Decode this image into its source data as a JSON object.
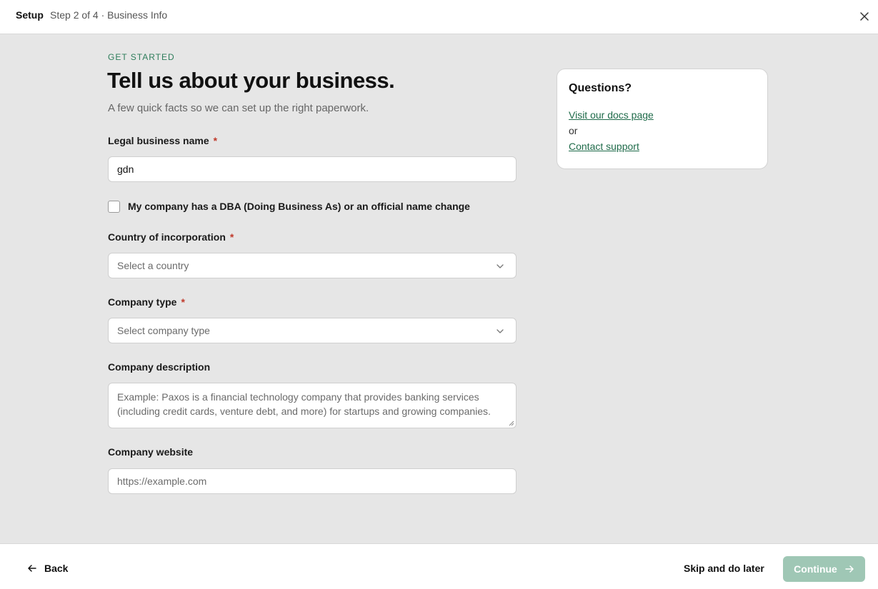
{
  "topbar": {
    "title": "Setup",
    "step": "Step 2 of 4 · Business Info"
  },
  "header": {
    "eyebrow": "GET STARTED",
    "headline": "Tell us about your business.",
    "subhead": "A few quick facts so we can set up the right paperwork."
  },
  "form": {
    "legal_name": {
      "label": "Legal business name",
      "required": "*",
      "value": "gdn"
    },
    "dba_checkbox": {
      "label": "My company has a DBA (Doing Business As) or an official name change",
      "checked": false
    },
    "country": {
      "label": "Country of incorporation",
      "required": "*",
      "placeholder": "Select a country"
    },
    "company_type": {
      "label": "Company type",
      "required": "*",
      "placeholder": "Select company type"
    },
    "description": {
      "label": "Company description",
      "placeholder": "Example: Paxos is a financial technology company that provides banking services (including credit cards, venture debt, and more) for startups and growing companies."
    },
    "website": {
      "label": "Company website",
      "placeholder": "https://example.com"
    }
  },
  "help_card": {
    "title": "Questions?",
    "docs_link": "Visit our docs page",
    "or": "or",
    "support_link": "Contact support"
  },
  "footer": {
    "back": "Back",
    "skip": "Skip and do later",
    "continue": "Continue"
  },
  "colors": {
    "accent": "#2e7d5b",
    "link": "#1f6b4a",
    "required": "#c0392b",
    "continue_disabled": "#9fc7b5",
    "page_bg": "#e6e6e6"
  }
}
